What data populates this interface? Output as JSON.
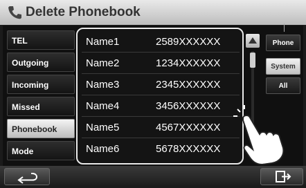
{
  "header": {
    "icon": "phone-icon",
    "title": "Delete Phonebook"
  },
  "menu": {
    "items": [
      {
        "label": "TEL",
        "active": false
      },
      {
        "label": "Outgoing",
        "active": false
      },
      {
        "label": "Incoming",
        "active": false
      },
      {
        "label": "Missed",
        "active": false
      },
      {
        "label": "Phonebook",
        "active": true
      },
      {
        "label": "Mode",
        "active": false
      }
    ]
  },
  "contacts": [
    {
      "name": "Name1",
      "number": "2589XXXXXX"
    },
    {
      "name": "Name2",
      "number": "1234XXXXXX"
    },
    {
      "name": "Name3",
      "number": "2345XXXXXX"
    },
    {
      "name": "Name4",
      "number": "3456XXXXXX"
    },
    {
      "name": "Name5",
      "number": "4567XXXXXX"
    },
    {
      "name": "Name6",
      "number": "5678XXXXXX"
    }
  ],
  "source": {
    "phone_label": "Phone",
    "system_label": "System",
    "all_label": "All",
    "selected": "System"
  },
  "footer": {
    "back_icon": "back-arrow-icon",
    "exit_icon": "exit-icon"
  },
  "colors": {
    "list_border": "#eaeaea",
    "active_button": "#d8d8d8",
    "background": "#1b1b1b"
  }
}
